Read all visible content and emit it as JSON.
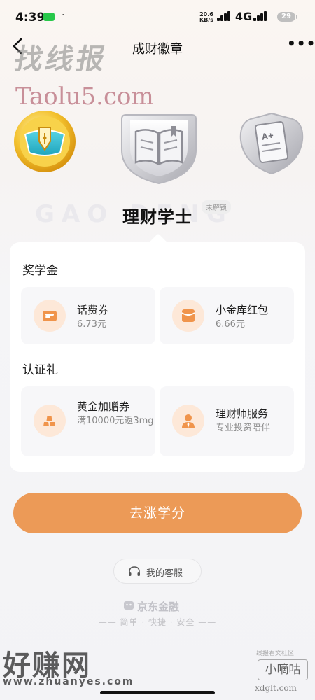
{
  "status_bar": {
    "time": "4:39",
    "dot": "·",
    "speed_value": "20.6",
    "speed_unit": "KB/s",
    "network": "4G",
    "battery": "29"
  },
  "nav": {
    "title": "成财徽章",
    "more_label": "•••"
  },
  "watermarks": {
    "top_cn": "找线报",
    "top_site": "Taolu5.com",
    "bottom_cn": "好赚网",
    "bottom_url": "www.zhuanyes.com",
    "xd_note": "线报看文社区",
    "xd_name": "小嘀咕",
    "xd_url": "xdglt.com"
  },
  "badges": [
    {
      "name": "pen-badge",
      "state": "unlocked"
    },
    {
      "name": "book-badge",
      "state": "selected-locked"
    },
    {
      "name": "grade-a-plus-badge",
      "state": "locked",
      "text": "A+"
    }
  ],
  "badge_detail": {
    "title": "理财学士",
    "status_tag": "未解锁"
  },
  "card": {
    "sections": [
      {
        "title": "奖学金",
        "items": [
          {
            "icon": "wallet-icon",
            "title": "话费券",
            "sub": "6.73元"
          },
          {
            "icon": "red-packet-icon",
            "title": "小金库红包",
            "sub": "6.66元"
          }
        ]
      },
      {
        "title": "认证礼",
        "items": [
          {
            "icon": "gold-bars-icon",
            "title": "黄金加赠券",
            "sub": "满10000元返3mg"
          },
          {
            "icon": "advisor-icon",
            "title": "理财师服务",
            "sub": "专业投资陪伴"
          }
        ]
      }
    ]
  },
  "cta": {
    "label": "去涨学分"
  },
  "service": {
    "label": "我的客服"
  },
  "footer": {
    "brand": "京东金融",
    "slogan": "—— 简单 · 快捷 · 安全 ——"
  },
  "colors": {
    "accent": "#ec9a57",
    "icon_bg": "#fde8d8",
    "icon_fg": "#f0944b"
  }
}
